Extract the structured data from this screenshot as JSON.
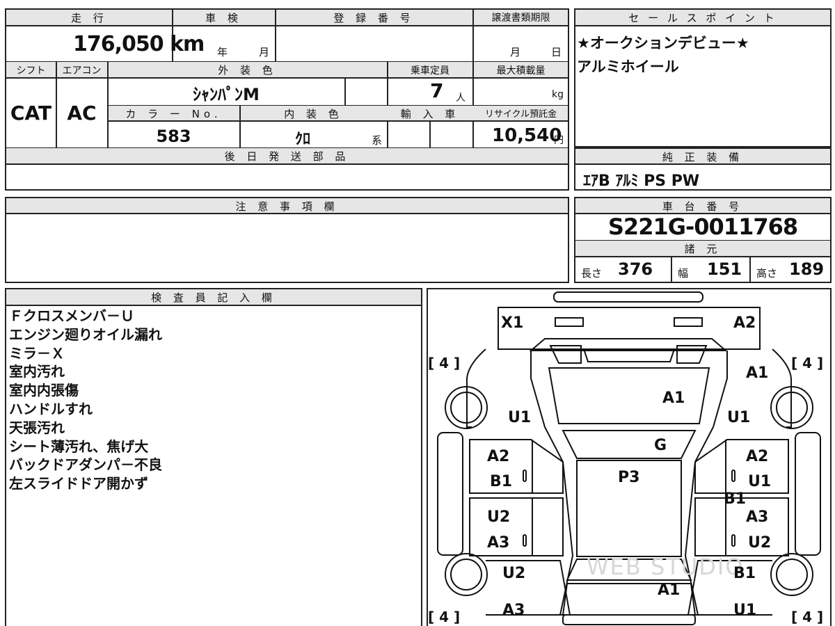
{
  "main_table": {
    "mileage_label": "走 行",
    "mileage_value": "176,050 km",
    "inspection_label": "車 検",
    "inspection_year_unit": "年",
    "inspection_month_unit": "月",
    "registration_label": "登 録 番 号",
    "transfer_deadline_label": "譲渡書類期限",
    "transfer_month_unit": "月",
    "transfer_day_unit": "日",
    "shift_label": "シフト",
    "shift_value": "CAT",
    "ac_label": "エアコン",
    "ac_value": "AC",
    "exterior_color_label": "外 装 色",
    "exterior_color_value": "ｼｬﾝﾊﾟﾝM",
    "capacity_label": "乗車定員",
    "capacity_value": "7",
    "capacity_unit": "人",
    "max_load_label": "最大積載量",
    "max_load_unit": "kg",
    "color_no_label": "カ ラ ー No.",
    "color_no_value": "583",
    "interior_color_label": "内 装 色",
    "interior_color_value": "ｸﾛ",
    "interior_color_suffix": "系",
    "import_label": "輸 入 車",
    "recycle_label": "リサイクル預託金",
    "recycle_value": "10,540",
    "recycle_unit": "円",
    "later_parts_label": "後 日 発 送 部 品"
  },
  "sales_points": {
    "label": "セ ー ル ス ポ イ ン ト",
    "lines": [
      "★オークションデビュー★",
      "アルミホイール"
    ]
  },
  "equipment": {
    "label": "純 正 装 備",
    "value": "ｴｱB  ｱﾙﾐ  PS  PW"
  },
  "notes": {
    "label": "注 意 事 項 欄"
  },
  "chassis": {
    "label": "車 台 番 号",
    "value": "S221G-0011768",
    "specs_label": "諸 元",
    "length_label": "長さ",
    "length_value": "376",
    "width_label": "幅",
    "width_value": "151",
    "height_label": "高さ",
    "height_value": "189"
  },
  "inspector": {
    "label": "検 査 員 記 入 欄",
    "lines": [
      "Ｆクロスメンバ－Ｕ",
      "エンジン廻りオイル漏れ",
      "ミラ－Ｘ",
      "室内汚れ",
      "室内内張傷",
      "ハンドルすれ",
      "天張汚れ",
      "シート薄汚れ、焦げ大",
      "バックドアダンパ－不良",
      "左スライドドア開かず"
    ]
  },
  "diagram": {
    "watermark": "WEB STUDIO",
    "tire_marks": [
      "[ 4 ]",
      "[ 4 ]",
      "[ 4 ]",
      "[ 4 ]"
    ],
    "codes": {
      "front_left": "X1",
      "front_right": "A2",
      "hood": "A1",
      "right_fender_top": "A1",
      "left_fender": "U1",
      "right_fender": "U1",
      "windshield": "G",
      "left_front_door_1": "A2",
      "left_front_door_2": "B1",
      "roof": "P3",
      "right_front_door_1": "A2",
      "right_front_door_2": "U1",
      "right_sill": "B1",
      "left_rear_door_1": "U2",
      "left_rear_door_2": "A3",
      "right_rear_door_1": "A3",
      "right_rear_door_2": "U2",
      "left_quarter": "U2",
      "right_quarter": "B1",
      "back_door": "A1",
      "left_rear_corner": "A3",
      "right_rear_corner": "U1"
    }
  }
}
